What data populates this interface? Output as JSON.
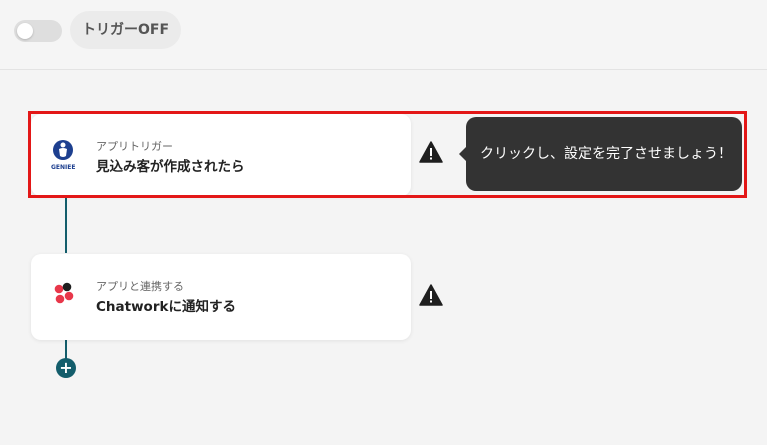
{
  "topbar": {
    "trigger_toggle_state": "off",
    "trigger_label": "トリガーOFF"
  },
  "flow": {
    "steps": [
      {
        "sub_label": "アプリトリガー",
        "title": "見込み客が作成されたら",
        "app_icon": "genie-logo-icon",
        "logo_text": "GENIEE",
        "status_icon": "warning-icon"
      },
      {
        "sub_label": "アプリと連携する",
        "title": "Chatworkに通知する",
        "app_icon": "chatwork-logo-icon",
        "status_icon": "warning-icon"
      }
    ],
    "add_step_icon": "plus-icon"
  },
  "tooltip": {
    "text": "クリックし、設定を完了させましょう！"
  },
  "colors": {
    "highlight": "#e31717",
    "connector": "#135d6b",
    "tooltip_bg": "#333333",
    "toggle_off": "#dedede"
  }
}
